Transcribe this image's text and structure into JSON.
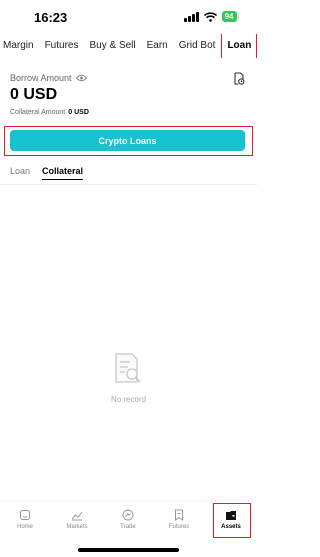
{
  "status_bar": {
    "time": "16:23",
    "battery": "94"
  },
  "top_tabs": [
    {
      "label": "Margin"
    },
    {
      "label": "Futures"
    },
    {
      "label": "Buy & Sell"
    },
    {
      "label": "Earn"
    },
    {
      "label": "Grid Bot"
    },
    {
      "label": "Loan",
      "active": true
    }
  ],
  "summary": {
    "borrow_label": "Borrow Amount",
    "borrow_value": "0 USD",
    "collateral_label": "Collateral Amount",
    "collateral_value": "0 USD"
  },
  "crypto_loans_button": "Crypto Loans",
  "sub_tabs": [
    {
      "label": "Loan"
    },
    {
      "label": "Collateral",
      "active": true
    }
  ],
  "empty_state": {
    "text": "No record"
  },
  "bottom_nav": [
    {
      "label": "Home",
      "icon": "home-icon"
    },
    {
      "label": "Markets",
      "icon": "markets-icon"
    },
    {
      "label": "Trade",
      "icon": "trade-icon"
    },
    {
      "label": "Futures",
      "icon": "futures-icon"
    },
    {
      "label": "Assets",
      "icon": "wallet-icon",
      "active": true
    }
  ],
  "colors": {
    "accent": "#19c0cf",
    "highlight_box": "#e11d2b",
    "battery": "#34c759"
  }
}
